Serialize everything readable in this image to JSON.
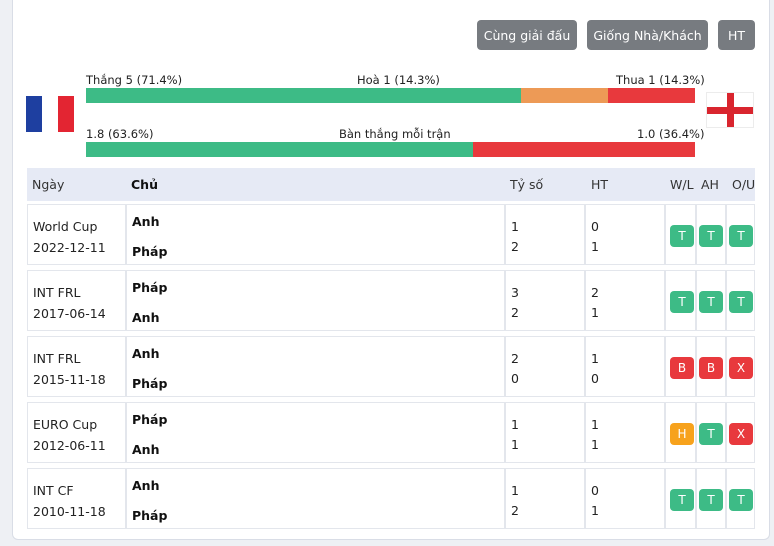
{
  "buttons": [
    {
      "label": "Cùng giải đấu"
    },
    {
      "label": "Giống Nhà/Khách"
    },
    {
      "label": "HT"
    }
  ],
  "flags": {
    "home": "france-flag-icon",
    "away": "england-flag-icon"
  },
  "stats": {
    "results": {
      "win_label": "Thắng 5 (71.4%)",
      "draw_label": "Hoà 1 (14.3%)",
      "loss_label": "Thua 1 (14.3%)",
      "win_pct": 71.4,
      "draw_pct": 14.3,
      "loss_pct": 14.3
    },
    "goals": {
      "home_label": "1.8 (63.6%)",
      "title": "Bàn thắng mỗi trận",
      "away_label": "1.0 (36.4%)",
      "home_pct": 63.6,
      "away_pct": 36.4
    }
  },
  "colors": {
    "win": "#3dbb86",
    "draw": "#ed9a56",
    "loss": "#e8393d",
    "badge_t": "#3dbb86",
    "badge_b": "#e8393d",
    "badge_h": "#f7a21c",
    "badge_x": "#e8393d"
  },
  "table": {
    "headers": {
      "date": "Ngày",
      "home": "Chủ",
      "score": "Tỷ số",
      "ht": "HT",
      "wl": "W/L",
      "ah": "AH",
      "ou": "O/U"
    },
    "rows": [
      {
        "competition": "World Cup",
        "date": "2022-12-11",
        "team1": "Anh",
        "team2": "Pháp",
        "score1": "1",
        "score2": "2",
        "ht1": "0",
        "ht2": "1",
        "wl": "T",
        "ah": "T",
        "ou": "T"
      },
      {
        "competition": "INT FRL",
        "date": "2017-06-14",
        "team1": "Pháp",
        "team2": "Anh",
        "score1": "3",
        "score2": "2",
        "ht1": "2",
        "ht2": "1",
        "wl": "T",
        "ah": "T",
        "ou": "T"
      },
      {
        "competition": "INT FRL",
        "date": "2015-11-18",
        "team1": "Anh",
        "team2": "Pháp",
        "score1": "2",
        "score2": "0",
        "ht1": "1",
        "ht2": "0",
        "wl": "B",
        "ah": "B",
        "ou": "X"
      },
      {
        "competition": "EURO Cup",
        "date": "2012-06-11",
        "team1": "Pháp",
        "team2": "Anh",
        "score1": "1",
        "score2": "1",
        "ht1": "1",
        "ht2": "1",
        "wl": "H",
        "ah": "T",
        "ou": "X"
      },
      {
        "competition": "INT CF",
        "date": "2010-11-18",
        "team1": "Anh",
        "team2": "Pháp",
        "score1": "1",
        "score2": "2",
        "ht1": "0",
        "ht2": "1",
        "wl": "T",
        "ah": "T",
        "ou": "T"
      }
    ]
  }
}
